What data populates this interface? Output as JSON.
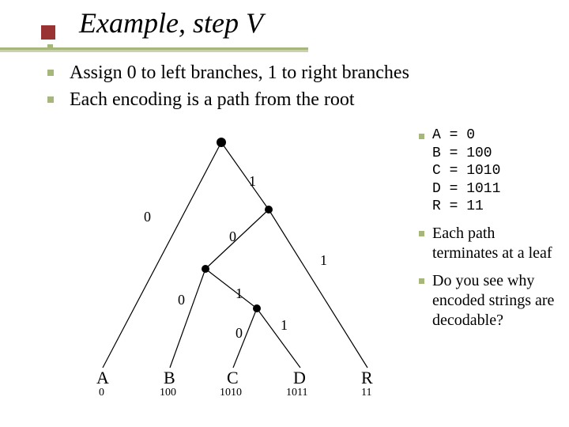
{
  "title": "Example, step V",
  "bullets": [
    "Assign 0 to left branches, 1 to right branches",
    "Each encoding is a path from the root"
  ],
  "right": {
    "codes": {
      "a": "A = 0",
      "b": "B = 100",
      "c": "C = 1010",
      "d": "D = 1011",
      "r": "R = 11"
    },
    "item2": "Each path terminates at a leaf",
    "item3": "Do you see why encoded strings are decodable?"
  },
  "diagram": {
    "edge_labels": {
      "l0": "0",
      "l1": "1",
      "l20": "0",
      "l21": "1",
      "l30": "0",
      "l31": "1",
      "l40": "0",
      "l41": "1"
    },
    "leaves": {
      "A": {
        "label": "A",
        "code": "0"
      },
      "B": {
        "label": "B",
        "code": "100"
      },
      "C": {
        "label": "C",
        "code": "1010"
      },
      "D": {
        "label": "D",
        "code": "1011"
      },
      "R": {
        "label": "R",
        "code": "11"
      }
    }
  },
  "chart_data": {
    "type": "diagram",
    "description": "Binary tree with 0 on left branches and 1 on right branches, producing Huffman-style codes",
    "nodes": [
      {
        "id": "root",
        "parent": null,
        "edge": null
      },
      {
        "id": "A",
        "parent": "root",
        "edge": "0",
        "leaf": true,
        "code": "0"
      },
      {
        "id": "n1",
        "parent": "root",
        "edge": "1"
      },
      {
        "id": "n10",
        "parent": "n1",
        "edge": "0"
      },
      {
        "id": "R",
        "parent": "n1",
        "edge": "1",
        "leaf": true,
        "code": "11"
      },
      {
        "id": "B",
        "parent": "n10",
        "edge": "0",
        "leaf": true,
        "code": "100"
      },
      {
        "id": "n101",
        "parent": "n10",
        "edge": "1"
      },
      {
        "id": "C",
        "parent": "n101",
        "edge": "0",
        "leaf": true,
        "code": "1010"
      },
      {
        "id": "D",
        "parent": "n101",
        "edge": "1",
        "leaf": true,
        "code": "1011"
      }
    ],
    "leaf_order": [
      "A",
      "B",
      "C",
      "D",
      "R"
    ],
    "codes": {
      "A": "0",
      "B": "100",
      "C": "1010",
      "D": "1011",
      "R": "11"
    }
  }
}
